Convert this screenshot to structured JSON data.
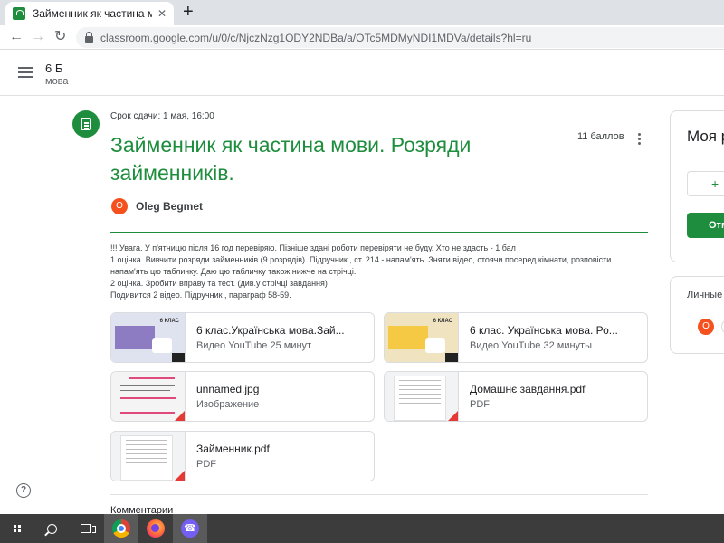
{
  "browser": {
    "tab_title": "Займенник як частина мови. Ро",
    "tab_close": "✕",
    "new_tab": "+",
    "back": "←",
    "forward": "→",
    "reload": "↻",
    "url": "classroom.google.com/u/0/c/NjczNzg1ODY2NDBa/a/OTc5MDMyNDI1MDVa/details?hl=ru"
  },
  "header": {
    "class_name": "6 Б",
    "class_subject": "мова"
  },
  "assignment": {
    "due": "Срок сдачи: 1 мая, 16:00",
    "title": "Займенник як частина мови. Розряди займенників.",
    "points": "11 баллов",
    "author_initial": "O",
    "author": "Oleg Begmet",
    "description": [
      "!!! Увага. У п'ятницю після 16 год перевіряю. Пізніше здані роботи перевіряти не буду. Хто не здасть - 1 бал",
      "1 оцінка. Вивчити розряди займенників (9 розрядів). Підручник , ст. 214 - напам'ять. Зняти відео, стоячи посеред кімнати, розповісти напам'ять цю табличку. Даю цю табличку також нижче на стрічці.",
      "2 оцінка. Зробити вправу та тест. (див.у стрічці завдання)",
      "Подивится 2 відео. Підручник , параграф 58-59."
    ]
  },
  "attachments": [
    {
      "name": "6 клас.Українська мова.Зай...",
      "type": "Видео YouTube   25 минут",
      "thumb_label": "6 КЛАС",
      "thumb_color": "#8e7cc3"
    },
    {
      "name": "6 клас. Українська мова. Ро...",
      "type": "Видео YouTube   32 минуты",
      "thumb_label": "6 КЛАС",
      "thumb_color": "#f6c945"
    },
    {
      "name": "unnamed.jpg",
      "type": "Изображение"
    },
    {
      "name": "Домашнє завдання.pdf",
      "type": "PDF"
    },
    {
      "name": "Займенник.pdf",
      "type": "PDF"
    }
  ],
  "comments_label": "Комментарии",
  "sidebar": {
    "my_work": "Моя р",
    "add_label": "+",
    "submit_label": "Отм",
    "private_comments": "Личные",
    "private_initial": "O"
  },
  "colors": {
    "accent_green": "#1e8e3e",
    "avatar_orange": "#f4511e",
    "pdf_red": "#e53935"
  },
  "icons": {
    "help": "?"
  }
}
